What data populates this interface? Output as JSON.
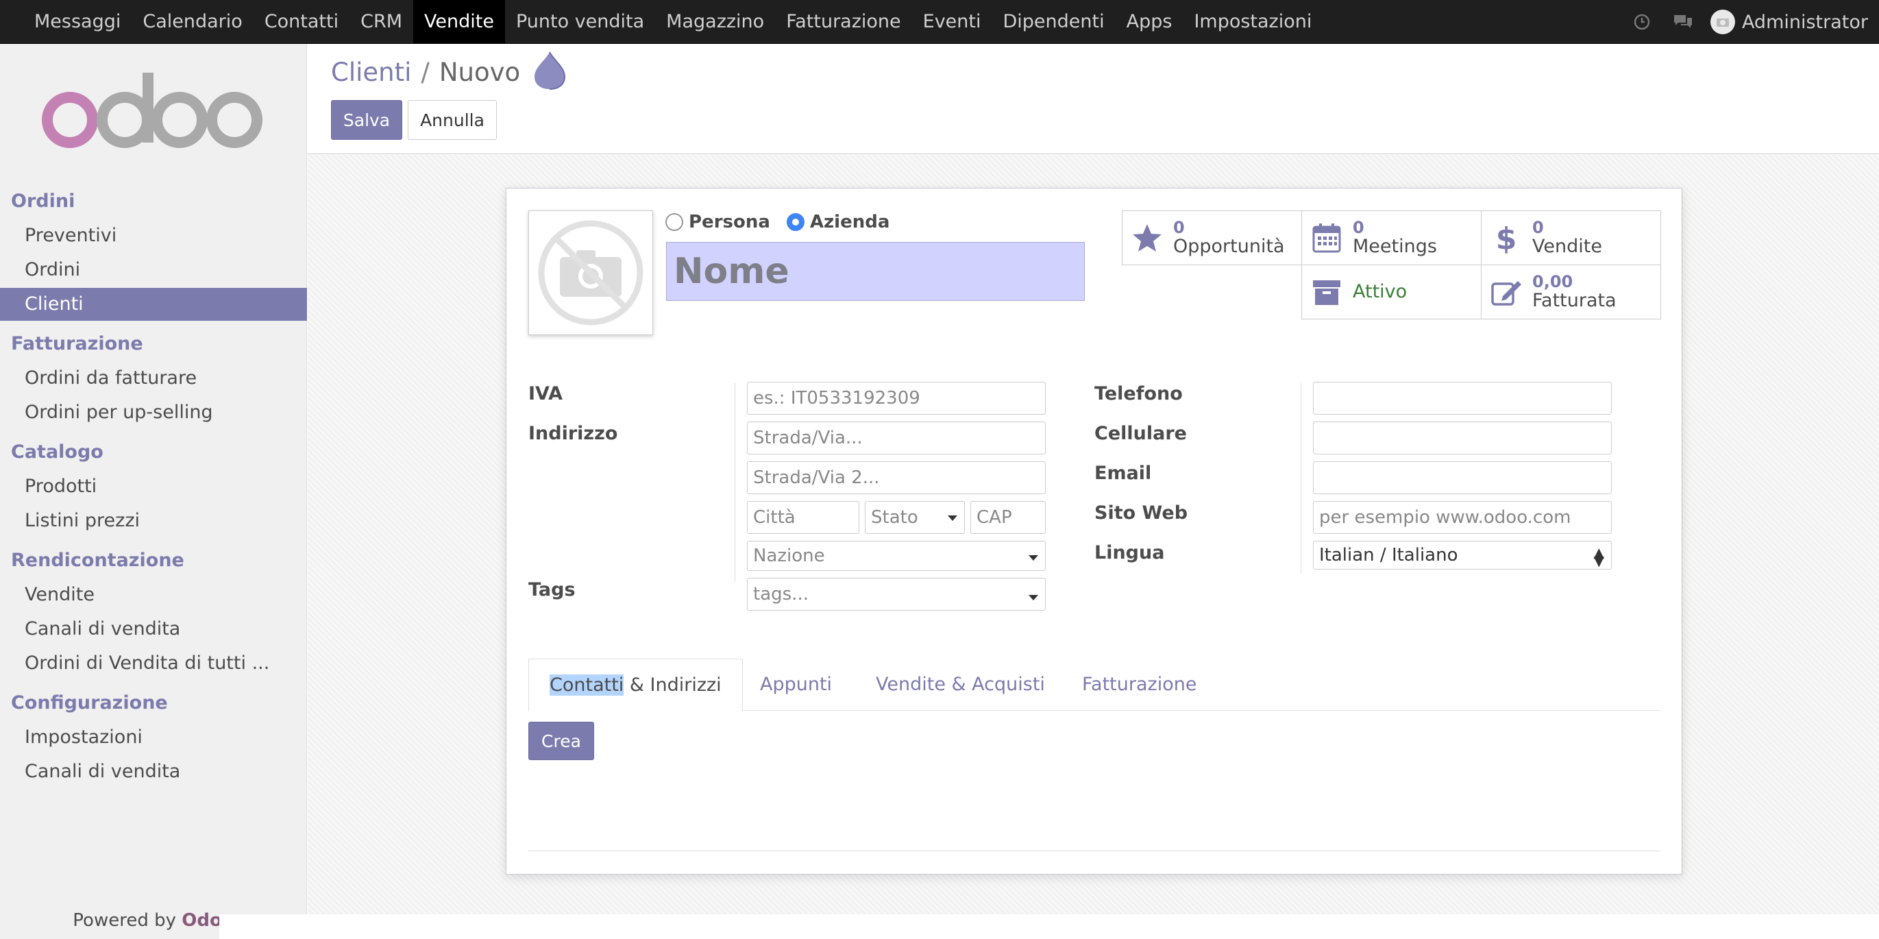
{
  "topmenu": {
    "items": [
      "Messaggi",
      "Calendario",
      "Contatti",
      "CRM",
      "Vendite",
      "Punto vendita",
      "Magazzino",
      "Fatturazione",
      "Eventi",
      "Dipendenti",
      "Apps",
      "Impostazioni"
    ],
    "active": "Vendite",
    "user": "Administrator",
    "icons": [
      "clock-icon",
      "chat-icon",
      "avatar-icon"
    ]
  },
  "sidebar": {
    "logo": "odoo",
    "sections": [
      {
        "title": "Ordini",
        "items": [
          "Preventivi",
          "Ordini",
          "Clienti"
        ]
      },
      {
        "title": "Fatturazione",
        "items": [
          "Ordini da fatturare",
          "Ordini per up-selling"
        ]
      },
      {
        "title": "Catalogo",
        "items": [
          "Prodotti",
          "Listini prezzi"
        ]
      },
      {
        "title": "Rendicontazione",
        "items": [
          "Vendite",
          "Canali di vendita",
          "Ordini di Vendita di tutti ..."
        ]
      },
      {
        "title": "Configurazione",
        "items": [
          "Impostazioni",
          "Canali di vendita"
        ]
      }
    ],
    "active_item": "Clienti",
    "powered_prefix": "Powered by",
    "powered_brand": "Odoo"
  },
  "breadcrumb": {
    "parent": "Clienti",
    "separator": "/",
    "current": "Nuovo"
  },
  "buttons": {
    "save": "Salva",
    "cancel": "Annulla",
    "create": "Crea"
  },
  "company_type": {
    "options": [
      "Persona",
      "Azienda"
    ],
    "selected": "Azienda"
  },
  "name_placeholder": "Nome",
  "stats": {
    "opportunities": {
      "value": "0",
      "label": "Opportunità"
    },
    "meetings": {
      "value": "0",
      "label": "Meetings"
    },
    "sales": {
      "value": "0",
      "label": "Vendite"
    },
    "active": {
      "label": "Attivo"
    },
    "invoiced": {
      "value": "0,00",
      "label": "Fatturata"
    }
  },
  "form_left": {
    "vat_label": "IVA",
    "vat_placeholder": "es.: IT0533192309",
    "address_label": "Indirizzo",
    "street_placeholder": "Strada/Via...",
    "street2_placeholder": "Strada/Via 2...",
    "city_placeholder": "Città",
    "state_placeholder": "Stato",
    "zip_placeholder": "CAP",
    "country_placeholder": "Nazione",
    "tags_label": "Tags",
    "tags_placeholder": "tags..."
  },
  "form_right": {
    "phone_label": "Telefono",
    "mobile_label": "Cellulare",
    "email_label": "Email",
    "website_label": "Sito Web",
    "website_placeholder": "per esempio www.odoo.com",
    "language_label": "Lingua",
    "language_value": "Italian / Italiano"
  },
  "tabs": {
    "contacts_highlight": "Contatti",
    "contacts_rest": " & Indirizzi",
    "notes": "Appunti",
    "sales_purchases": "Vendite & Acquisti",
    "invoicing": "Fatturazione"
  },
  "colors": {
    "accent": "#7c7bad",
    "topbar": "#1f1f1f",
    "name_field": "#d2d2ff",
    "active_green": "#3a7e35"
  }
}
